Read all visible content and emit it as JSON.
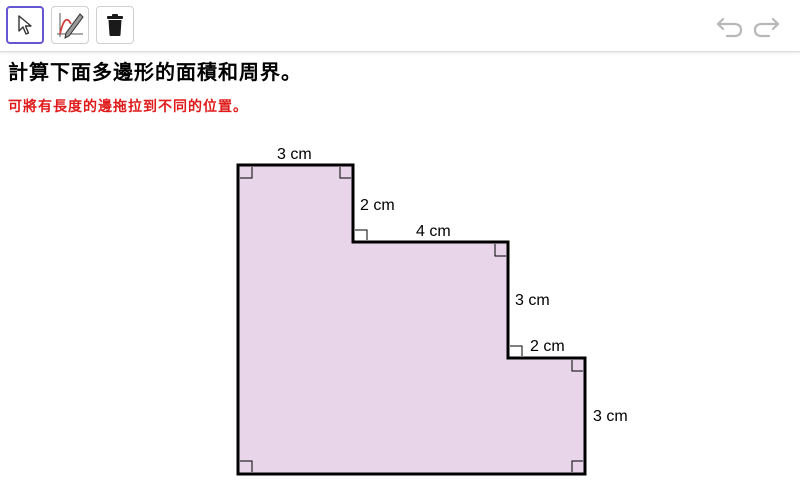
{
  "toolbar": {
    "tools": [
      {
        "icon": "arrow-pointer-icon",
        "selected": true
      },
      {
        "icon": "freehand-pen-icon",
        "selected": false
      },
      {
        "icon": "trash-icon",
        "selected": false
      }
    ],
    "undo_icon": "undo-icon",
    "redo_icon": "redo-icon"
  },
  "title": "計算下面多邊形的面積和周界。",
  "subtitle": "可將有長度的邊拖拉到不同的位置。",
  "colors": {
    "shape_fill": "#e8d5ea",
    "shape_stroke": "#000000",
    "subtitle": "#e01b1b",
    "selected_tool_border": "#6557d2"
  },
  "polygon": {
    "labels": {
      "top": "3 cm",
      "step1_vertical": "2 cm",
      "step1_horizontal": "4 cm",
      "step2_vertical": "3 cm",
      "step2_horizontal": "2 cm",
      "right_vertical": "3 cm"
    }
  }
}
